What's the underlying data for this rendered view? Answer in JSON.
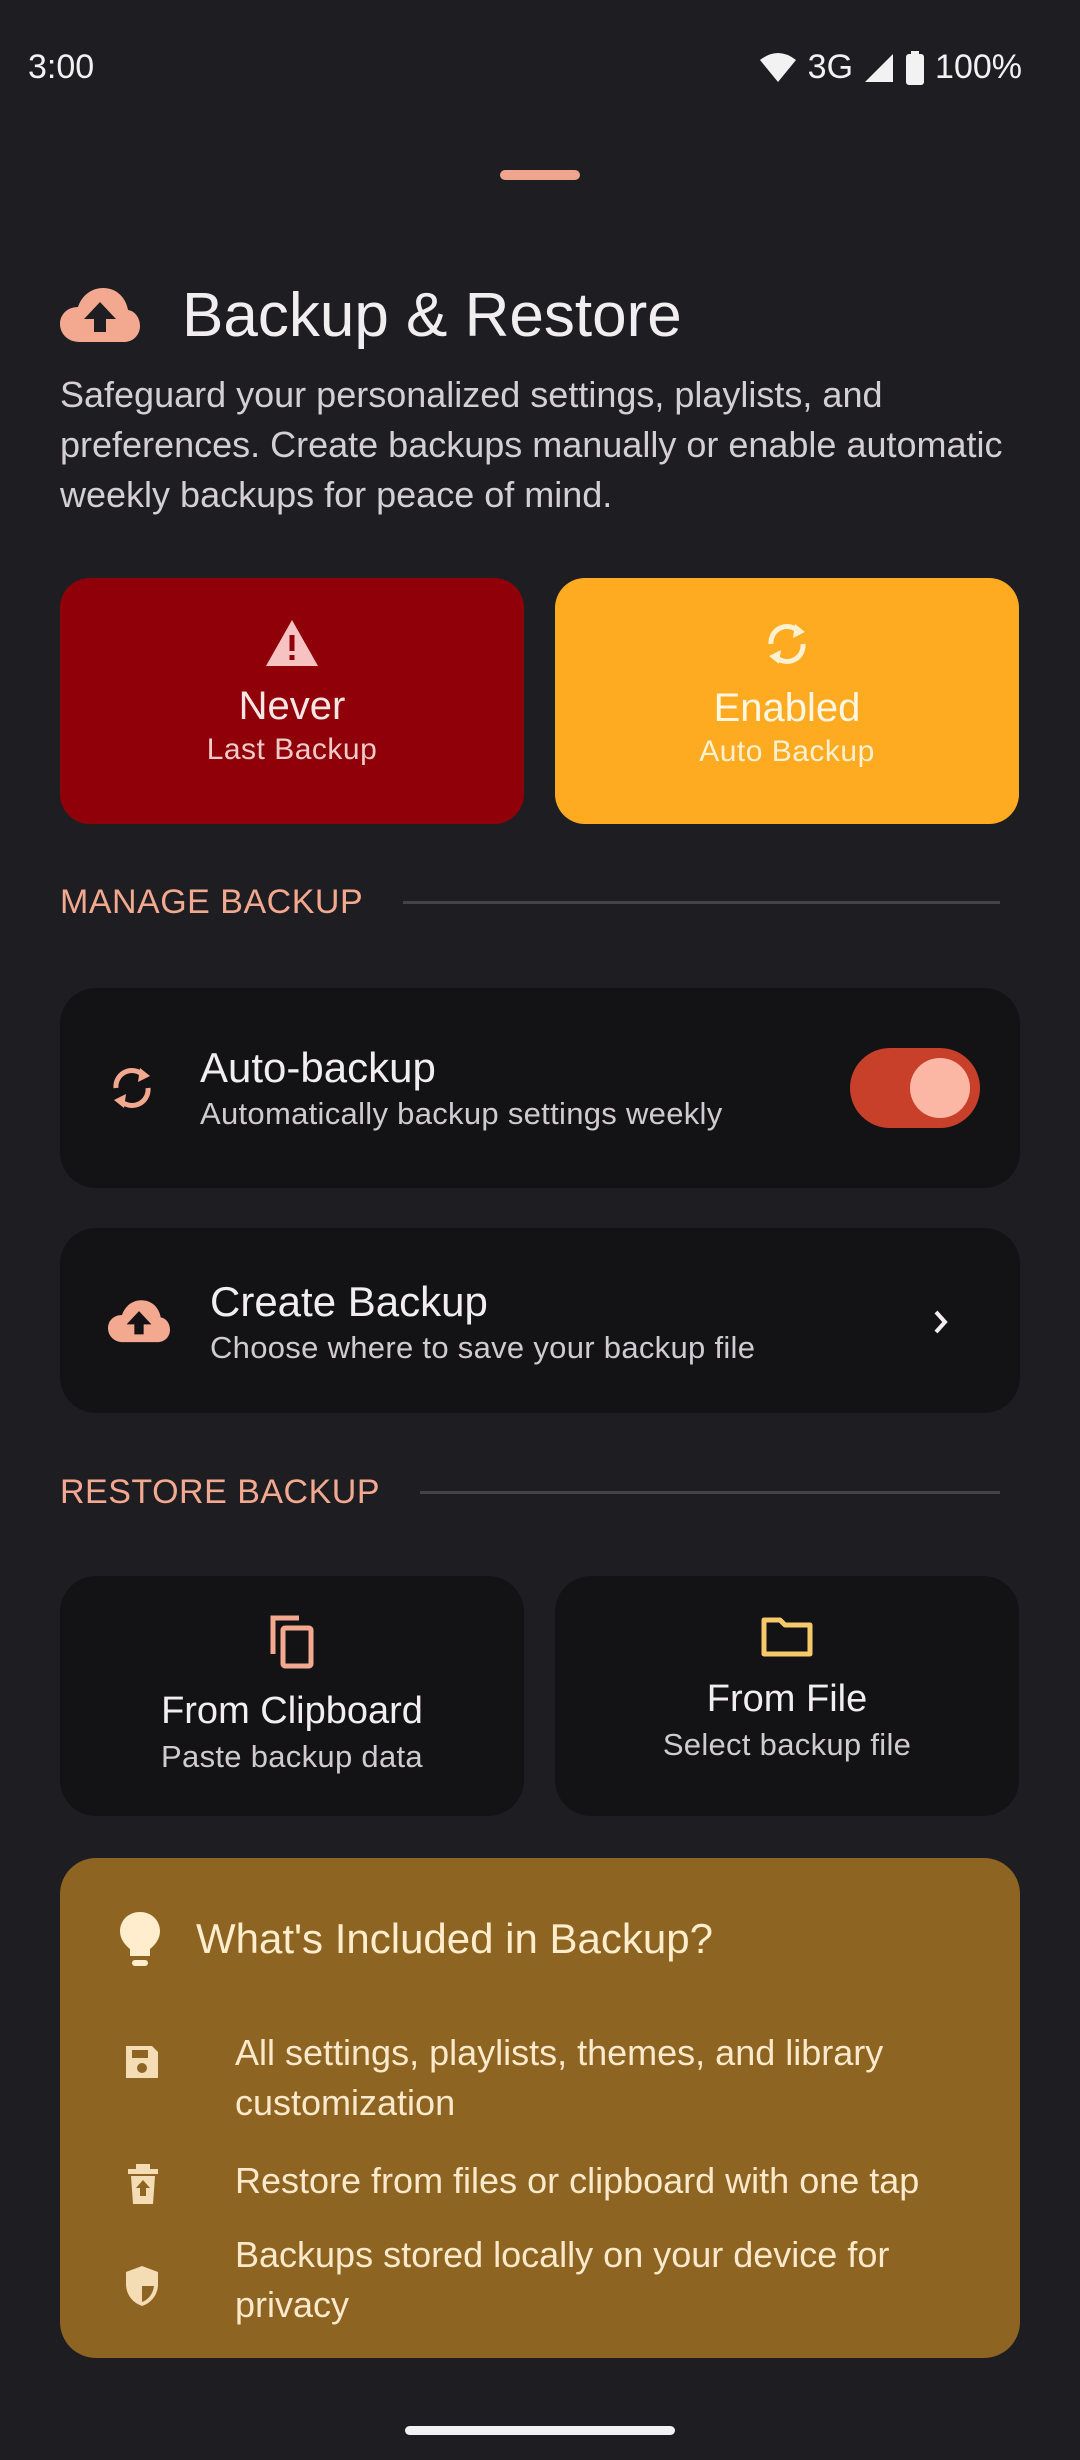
{
  "status_bar": {
    "time": "3:00",
    "network": "3G",
    "battery": "100%"
  },
  "header": {
    "title": "Backup & Restore",
    "icon": "cloud-upload-icon",
    "description": "Safeguard your personalized settings, playlists, and preferences. Create backups manually or enable automatic weekly backups for peace of mind."
  },
  "stats": {
    "last_backup": {
      "value": "Never",
      "label": "Last Backup",
      "icon": "warning-icon",
      "color": "#900008"
    },
    "auto_backup": {
      "value": "Enabled",
      "label": "Auto Backup",
      "icon": "sync-icon",
      "color": "#ffab22"
    }
  },
  "manage": {
    "section_title": "MANAGE BACKUP",
    "auto_backup": {
      "title": "Auto-backup",
      "subtitle": "Automatically backup settings weekly",
      "enabled": true
    },
    "create_backup": {
      "title": "Create Backup",
      "subtitle": "Choose where to save your backup file"
    }
  },
  "restore": {
    "section_title": "RESTORE BACKUP",
    "clipboard": {
      "title": "From Clipboard",
      "subtitle": "Paste backup data",
      "icon": "copy-icon"
    },
    "file": {
      "title": "From File",
      "subtitle": "Select backup file",
      "icon": "folder-icon"
    }
  },
  "info": {
    "title": "What's Included in Backup?",
    "items": [
      {
        "icon": "save-icon",
        "text": "All settings, playlists, themes, and library customization"
      },
      {
        "icon": "restore-icon",
        "text": "Restore from files or clipboard with one tap"
      },
      {
        "icon": "shield-icon",
        "text": "Backups stored locally on your device for privacy"
      }
    ]
  },
  "colors": {
    "accent": "#f3a98f",
    "background": "#1e1e22",
    "card": "#131316",
    "info_card": "#8d6422",
    "toggle_on": "#c8402a"
  }
}
